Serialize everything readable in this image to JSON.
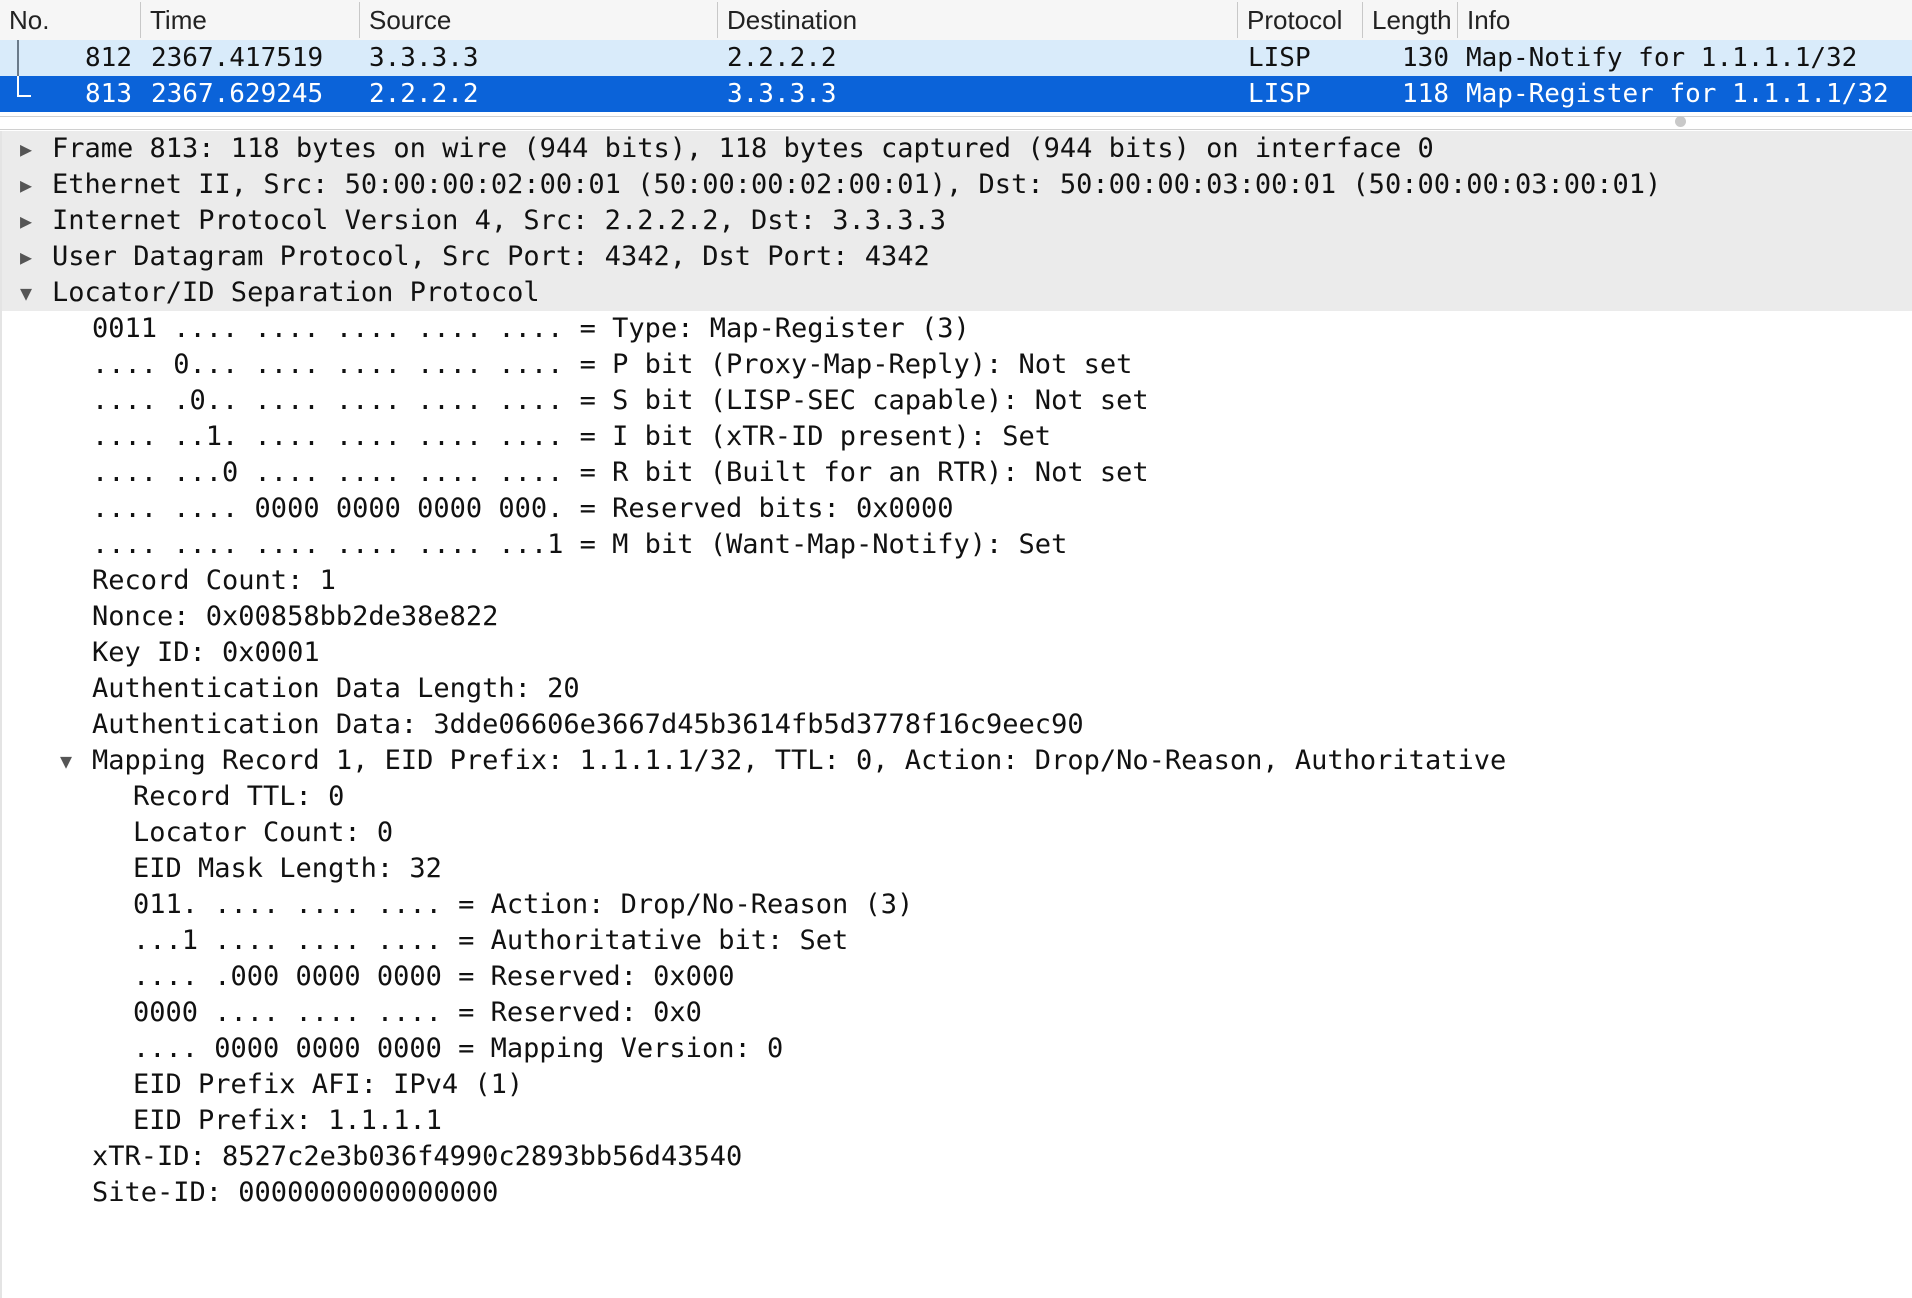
{
  "columns": {
    "no": "No.",
    "time": "Time",
    "source": "Source",
    "destination": "Destination",
    "protocol": "Protocol",
    "length": "Length",
    "info": "Info"
  },
  "packets": [
    {
      "no": "812",
      "time": "2367.417519",
      "source": "3.3.3.3",
      "destination": "2.2.2.2",
      "protocol": "LISP",
      "length": "130",
      "info": "Map-Notify for 1.1.1.1/32"
    },
    {
      "no": "813",
      "time": "2367.629245",
      "source": "2.2.2.2",
      "destination": "3.3.3.3",
      "protocol": "LISP",
      "length": "118",
      "info": "Map-Register for 1.1.1.1/32"
    }
  ],
  "details": {
    "frame": "Frame 813: 118 bytes on wire (944 bits), 118 bytes captured (944 bits) on interface 0",
    "ethernet": "Ethernet II, Src: 50:00:00:02:00:01 (50:00:00:02:00:01), Dst: 50:00:00:03:00:01 (50:00:00:03:00:01)",
    "ipv4": "Internet Protocol Version 4, Src: 2.2.2.2, Dst: 3.3.3.3",
    "udp": "User Datagram Protocol, Src Port: 4342, Dst Port: 4342",
    "lisp": "Locator/ID Separation Protocol",
    "lisp_fields": [
      "0011 .... .... .... .... .... = Type: Map-Register (3)",
      ".... 0... .... .... .... .... = P bit (Proxy-Map-Reply): Not set",
      ".... .0.. .... .... .... .... = S bit (LISP-SEC capable): Not set",
      ".... ..1. .... .... .... .... = I bit (xTR-ID present): Set",
      ".... ...0 .... .... .... .... = R bit (Built for an RTR): Not set",
      ".... .... 0000 0000 0000 000. = Reserved bits: 0x0000",
      ".... .... .... .... .... ...1 = M bit (Want-Map-Notify): Set",
      "Record Count: 1",
      "Nonce: 0x00858bb2de38e822",
      "Key ID: 0x0001",
      "Authentication Data Length: 20",
      "Authentication Data: 3dde06606e3667d45b3614fb5d3778f16c9eec90"
    ],
    "mapping_record": "Mapping Record 1, EID Prefix: 1.1.1.1/32, TTL: 0, Action: Drop/No-Reason, Authoritative",
    "mapping_fields": [
      "Record TTL: 0",
      "Locator Count: 0",
      "EID Mask Length: 32",
      "011. .... .... .... = Action: Drop/No-Reason (3)",
      "...1 .... .... .... = Authoritative bit: Set",
      ".... .000 0000 0000 = Reserved: 0x000",
      "0000 .... .... .... = Reserved: 0x0",
      ".... 0000 0000 0000 = Mapping Version: 0",
      "EID Prefix AFI: IPv4 (1)",
      "EID Prefix: 1.1.1.1"
    ],
    "xtr_id": "xTR-ID: 8527c2e3b036f4990c2893bb56d43540",
    "site_id": "Site-ID: 0000000000000000"
  },
  "icons": {
    "collapsed": "triangle-right-icon",
    "expanded": "triangle-down-icon"
  },
  "colors": {
    "selected_row": "#0b63d9",
    "related_row": "#d9ebfa",
    "header_bg": "#f6f6f6",
    "protocol_header_bg": "#ebebeb"
  }
}
